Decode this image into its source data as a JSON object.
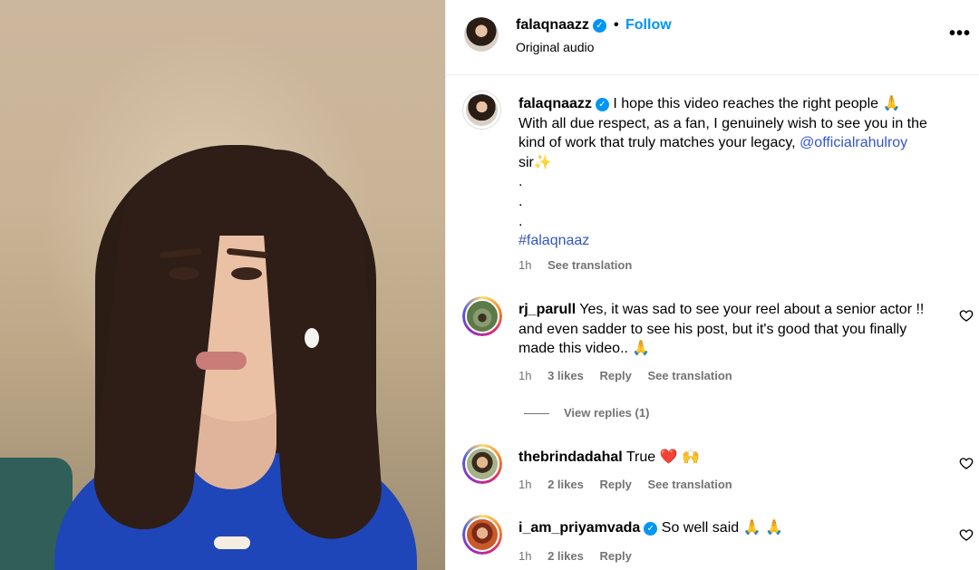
{
  "post": {
    "username": "falaqnaazz",
    "follow_label": "Follow",
    "separator": "•",
    "audio": "Original audio",
    "more": "•••"
  },
  "caption": {
    "username": "falaqnaazz",
    "line1": "I hope this video reaches the right people 🙏",
    "line2": "With all due respect, as a fan, I genuinely wish to see you in the kind of work that truly matches your legacy,",
    "mention": "@officialrahulroy",
    "line3": "sir✨",
    "dot1": ".",
    "dot2": ".",
    "dot3": ".",
    "hashtag": "#falaqnaaz",
    "time": "1h",
    "see_translation": "See translation"
  },
  "comments": [
    {
      "username": "rj_parull",
      "text": "Yes, it was sad to see your reel about a senior actor !! and even sadder to see his post, but it's good that you finally made this video.. 🙏",
      "time": "1h",
      "likes": "3 likes",
      "reply": "Reply",
      "see_translation": "See translation",
      "view_replies": "View replies (1)"
    },
    {
      "username": "thebrindadahal",
      "text": "True ❤️ 🙌",
      "time": "1h",
      "likes": "2 likes",
      "reply": "Reply",
      "see_translation": "See translation"
    },
    {
      "username": "i_am_priyamvada",
      "text": "So well said 🙏 🙏",
      "time": "1h",
      "likes": "2 likes",
      "reply": "Reply"
    }
  ],
  "colors": {
    "accent": "#0095f6",
    "link": "#3555c8",
    "muted": "#737373"
  }
}
